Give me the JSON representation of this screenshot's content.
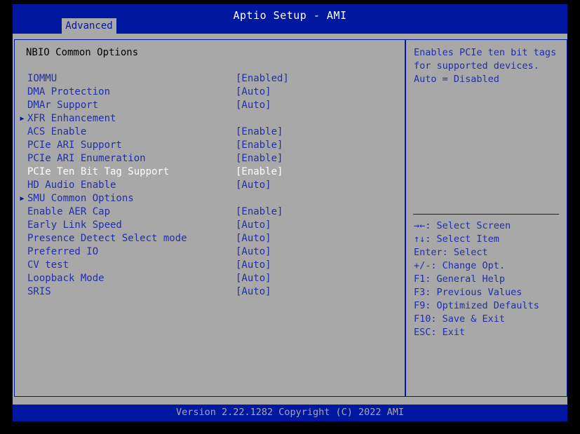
{
  "window": {
    "title": "Aptio Setup - AMI"
  },
  "tabs": [
    {
      "label": "Advanced",
      "active": true
    }
  ],
  "main": {
    "section_title": "NBIO Common Options",
    "selected_index": 7,
    "items": [
      {
        "label": "IOMMU",
        "value": "[Enabled]",
        "submenu": false
      },
      {
        "label": "DMA Protection",
        "value": "[Auto]",
        "submenu": false
      },
      {
        "label": "DMAr Support",
        "value": "[Auto]",
        "submenu": false
      },
      {
        "label": "XFR Enhancement",
        "value": "",
        "submenu": true
      },
      {
        "label": "ACS Enable",
        "value": "[Enable]",
        "submenu": false
      },
      {
        "label": "PCIe ARI Support",
        "value": "[Enable]",
        "submenu": false
      },
      {
        "label": "PCIe ARI Enumeration",
        "value": "[Enable]",
        "submenu": false
      },
      {
        "label": "PCIe Ten Bit Tag Support",
        "value": "[Enable]",
        "submenu": false
      },
      {
        "label": "HD Audio Enable",
        "value": "[Auto]",
        "submenu": false
      },
      {
        "label": "SMU Common Options",
        "value": "",
        "submenu": true
      },
      {
        "label": "Enable AER Cap",
        "value": "[Enable]",
        "submenu": false
      },
      {
        "label": "Early Link Speed",
        "value": "[Auto]",
        "submenu": false
      },
      {
        "label": "Presence Detect Select mode",
        "value": "[Auto]",
        "submenu": false
      },
      {
        "label": "Preferred IO",
        "value": "[Auto]",
        "submenu": false
      },
      {
        "label": "CV test",
        "value": "[Auto]",
        "submenu": false
      },
      {
        "label": "Loopback Mode",
        "value": "[Auto]",
        "submenu": false
      },
      {
        "label": "SRIS",
        "value": "[Auto]",
        "submenu": false
      }
    ]
  },
  "help": {
    "description": "Enables PCIe ten bit tags\nfor supported devices.\nAuto = Disabled",
    "keys": [
      {
        "key": "→←",
        "action": ": Select Screen"
      },
      {
        "key": "↑↓",
        "action": ": Select Item"
      },
      {
        "key": "Enter",
        "action": ": Select"
      },
      {
        "key": "+/-",
        "action": ": Change Opt."
      },
      {
        "key": "F1",
        "action": ": General Help"
      },
      {
        "key": "F3",
        "action": ": Previous Values"
      },
      {
        "key": "F9",
        "action": ": Optimized Defaults"
      },
      {
        "key": "F10",
        "action": ": Save & Exit"
      },
      {
        "key": "ESC",
        "action": ": Exit"
      }
    ]
  },
  "footer": {
    "version": "Version 2.22.1282 Copyright (C) 2022 AMI"
  },
  "colors": {
    "header_blue": "#00179f",
    "panel_gray": "#a8a8a8",
    "text_blue": "#1f2fa8",
    "selected_white": "#ffffff",
    "title_black": "#000000"
  },
  "icons": {
    "submenu_arrow": "▶"
  }
}
